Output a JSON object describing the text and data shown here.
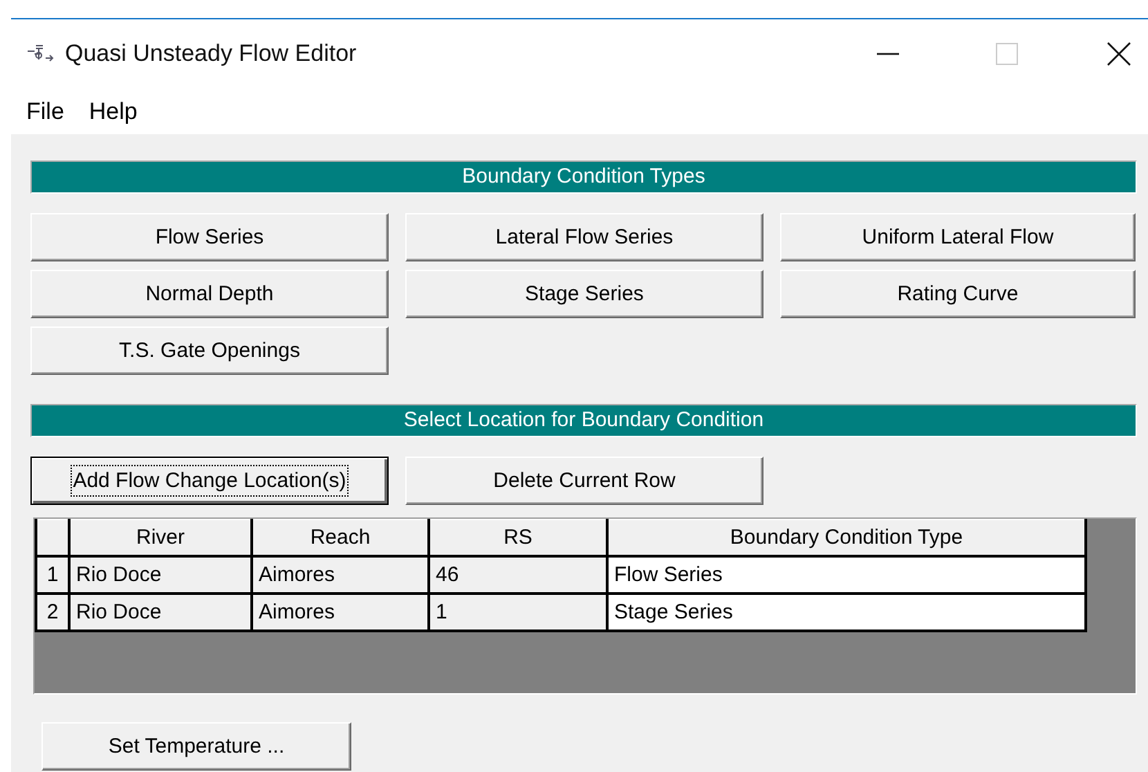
{
  "window": {
    "title": "Quasi Unsteady Flow Editor"
  },
  "menu": [
    "File",
    "Help"
  ],
  "boundary_types": {
    "title": "Boundary Condition Types",
    "buttons": [
      "Flow Series",
      "Lateral Flow Series",
      "Uniform Lateral Flow",
      "Normal Depth",
      "Stage Series",
      "Rating Curve",
      "T.S. Gate Openings"
    ]
  },
  "location": {
    "title": "Select Location for Boundary Condition",
    "buttons": [
      {
        "label": "Add Flow Change Location(s)",
        "focused": true
      },
      {
        "label": "Delete Current Row",
        "focused": false
      }
    ]
  },
  "table": {
    "columns": [
      "River",
      "Reach",
      "RS",
      "Boundary Condition Type"
    ],
    "rows": [
      {
        "number": "1",
        "cells": [
          "Rio Doce",
          "Aimores",
          "46",
          "Flow Series"
        ]
      },
      {
        "number": "2",
        "cells": [
          "Rio Doce",
          "Aimores",
          "1",
          "Stage Series"
        ]
      }
    ]
  },
  "footer_button": "Set Temperature ..."
}
